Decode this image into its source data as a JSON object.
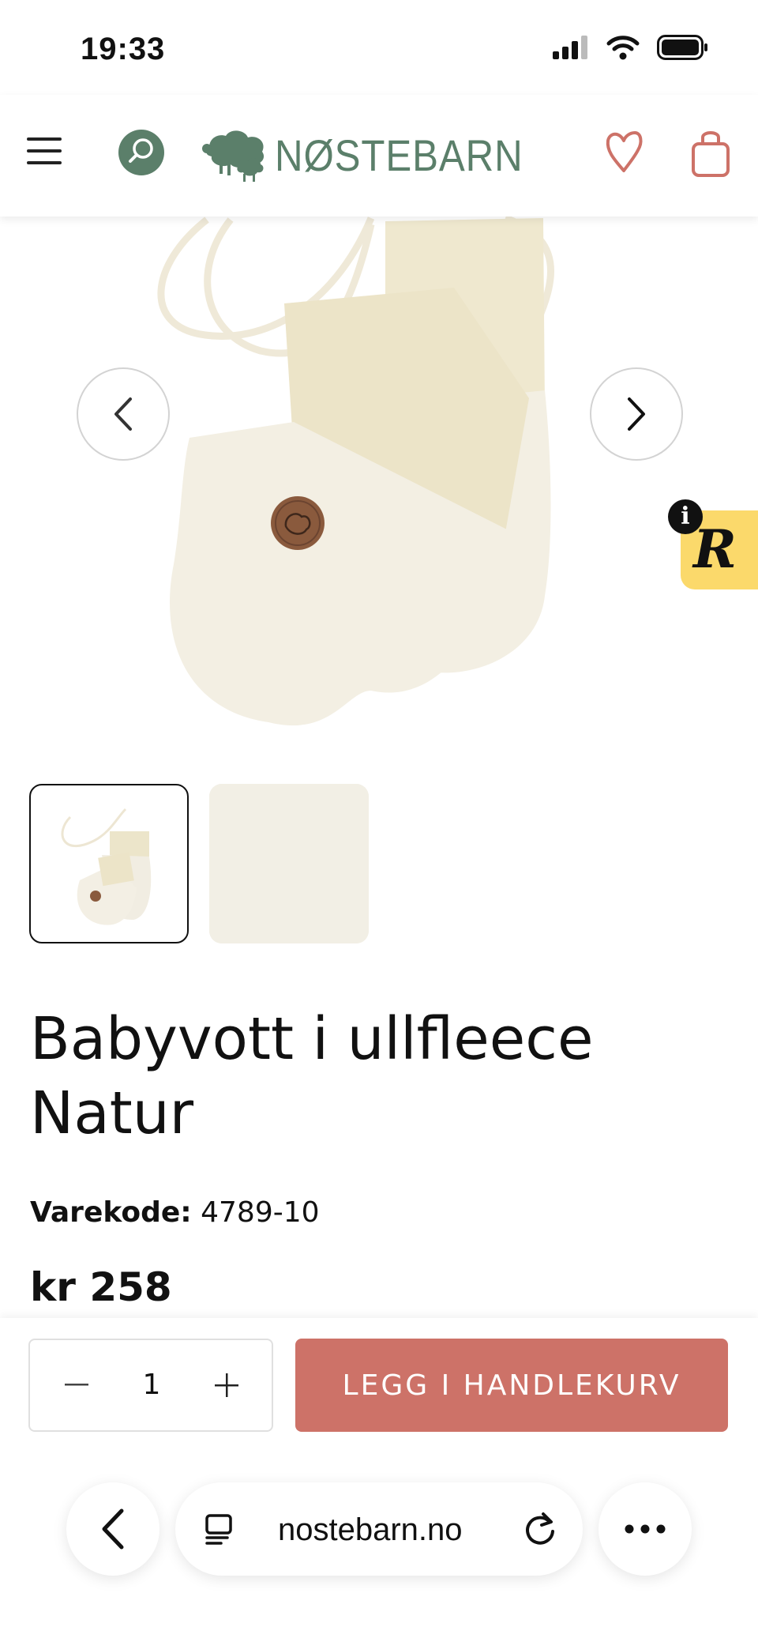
{
  "status_bar": {
    "time": "19:33"
  },
  "header": {
    "logo_text": "NØSTEBARN"
  },
  "product": {
    "title_line1": "Babyvott i ullfleece",
    "title_line2": "Natur",
    "sku_label": "Varekode:",
    "sku_value": "4789-10",
    "price": "kr 258"
  },
  "cart": {
    "quantity": "1",
    "add_label": "LEGG I HANDLEKURV"
  },
  "browser": {
    "url": "nostebarn.no"
  },
  "colors": {
    "brand_green": "#5b7f6a",
    "accent_coral": "#cd7268",
    "reviews_yellow": "#fbd96b"
  },
  "icons": [
    "signal-icon",
    "wifi-icon",
    "battery-icon",
    "menu-icon",
    "search-icon",
    "heart-icon",
    "shopping-bag-icon",
    "chevron-left-icon",
    "chevron-right-icon",
    "info-icon",
    "minus-icon",
    "plus-icon",
    "tabs-icon",
    "reload-icon",
    "more-icon"
  ]
}
